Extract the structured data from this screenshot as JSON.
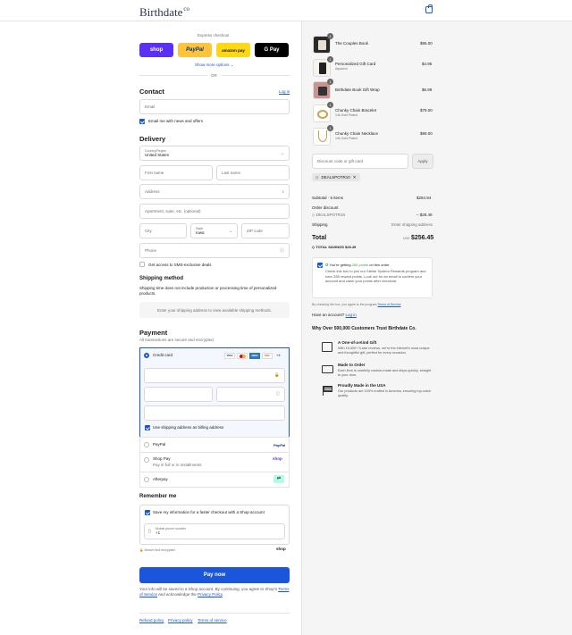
{
  "header": {
    "brand": "Birthdate",
    "brand_suffix": "co"
  },
  "express": {
    "title": "Express checkout",
    "shop": "shop",
    "paypal": "PayPal",
    "amazon": "amazon pay",
    "gpay": "G Pay",
    "more": "Show more options",
    "or": "OR"
  },
  "contact": {
    "title": "Contact",
    "login": "Log in",
    "email_placeholder": "Email",
    "news": "Email me with news and offers"
  },
  "delivery": {
    "title": "Delivery",
    "country_label": "Country/Region",
    "country": "United States",
    "first": "First name",
    "last": "Last name",
    "address": "Address",
    "apt": "Apartment, suite, etc. (optional)",
    "city": "City",
    "state_label": "State",
    "state": "Iowa",
    "zip": "ZIP code",
    "phone": "Phone",
    "sms": "Get access to SMS-exclusive deals"
  },
  "shipping": {
    "title": "Shipping method",
    "note": "Shipping time does not include production or processing time of personalized products.",
    "placeholder": "Enter your shipping address to view available shipping methods."
  },
  "payment": {
    "title": "Payment",
    "subtitle": "All transactions are secure and encrypted.",
    "credit": "Credit card",
    "cards": [
      "VISA",
      "MC",
      "AMEX",
      "DISC"
    ],
    "more_cards": "+4",
    "billing": "Use shipping address as billing address",
    "paypal": "PayPal",
    "paypal_logo": "PayPal",
    "shoppay": "Shop Pay",
    "shoppay_sub": "Pay in full or in installments",
    "shop_logo": "shop",
    "afterpay": "Afterpay"
  },
  "remember": {
    "title": "Remember me",
    "save": "Save my information for a faster checkout with a Shop account",
    "phone_label": "Mobile phone number",
    "phone_prefix": "+1",
    "secure": "Secure and encrypted",
    "shop_logo": "shop"
  },
  "pay_now": "Pay now",
  "legal": {
    "line1": "Your info will be saved to a Shop account. By continuing, you agree to Shop's",
    "terms": "Terms of Service",
    "and": "and acknowledge the",
    "privacy": "Privacy Policy",
    "end": "."
  },
  "footer": {
    "refund": "Refund policy",
    "privacy": "Privacy policy",
    "terms": "Terms of service"
  },
  "items": [
    {
      "qty": "1",
      "name": "The Couples Book",
      "sub": "",
      "price": "$95.00"
    },
    {
      "qty": "1",
      "name": "Personalized Gift Card",
      "sub": "Aquarius",
      "price": "$4.95"
    },
    {
      "qty": "1",
      "name": "Birthdate Book Gift Wrap",
      "sub": "",
      "price": "$6.99"
    },
    {
      "qty": "1",
      "name": "Chunky Chain Bracelet",
      "sub": "14k Gold Plated",
      "price": "$79.00"
    },
    {
      "qty": "1",
      "name": "Chunky Chain Necklace",
      "sub": "14k Gold Plated",
      "price": "$99.00"
    }
  ],
  "discount": {
    "placeholder": "Discount code or gift card",
    "apply": "Apply",
    "code": "DEALSPOTR10"
  },
  "summary": {
    "subtotal_label": "Subtotal · 5 items",
    "subtotal": "$284.94",
    "order_discount": "Order discount",
    "code": "DEALSPOTR10",
    "discount": "– $28.49",
    "shipping_label": "Shipping",
    "shipping": "Enter shipping address",
    "total_label": "Total",
    "currency": "USD",
    "total": "$256.45",
    "savings_label": "TOTAL SAVINGS",
    "savings": "$28.49"
  },
  "rewards": {
    "line1a": "You're getting ",
    "points": "285 points",
    "line1b": " on this order.",
    "body": "Check this box to join our Stellar System Rewards program and earn 285 reward points. Look out for an email to confirm your account and claim your points after checkout.",
    "agree": "By checking the box, you agree to the program",
    "terms": "Terms of Service",
    "account": "Have an account?",
    "login": "Log in"
  },
  "trust": {
    "title": "Why Over 500,000 Customers Trust Birthdate Co.",
    "items": [
      {
        "icon": "gift-icon",
        "title": "A One-of-a-Kind Gift",
        "body": "With 15,000+ 5-star reviews, we're the internet's most unique and thoughtful gift, perfect for every occasion."
      },
      {
        "icon": "truck-icon",
        "title": "Made to Order",
        "body": "Each item is carefully custom-made and ships quickly, straight to your door."
      },
      {
        "icon": "flag-icon",
        "title": "Proudly Made in the USA",
        "body": "Our products are 100% crafted in America, ensuring top-notch quality."
      }
    ]
  }
}
